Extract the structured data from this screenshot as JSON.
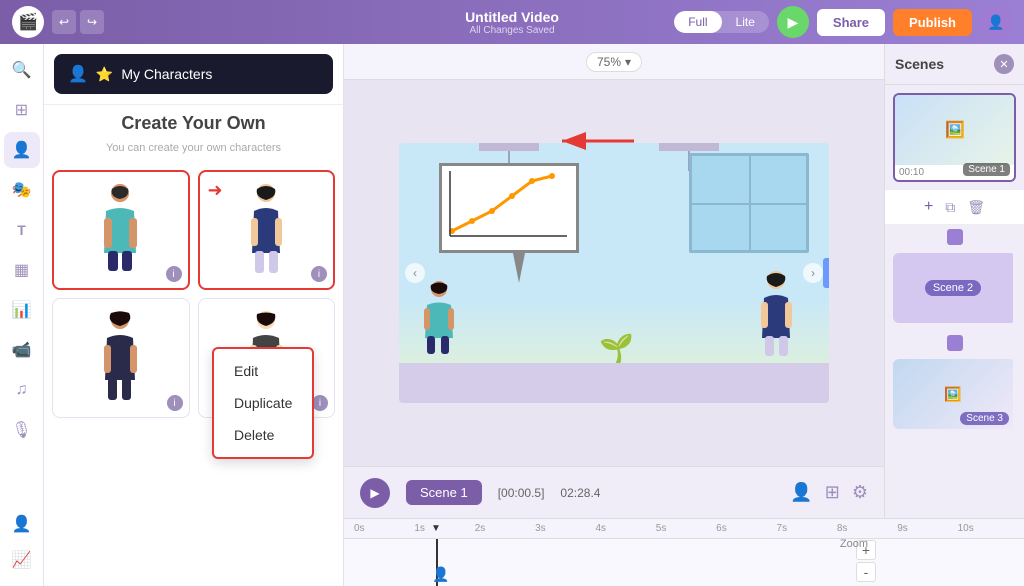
{
  "app": {
    "logo": "🎬",
    "title": "Untitled Video",
    "subtitle": "All Changes Saved",
    "toggle": {
      "full": "Full",
      "lite": "Lite"
    },
    "play_btn": "▶",
    "share_btn": "Share",
    "publish_btn": "Publish"
  },
  "left_nav": {
    "items": [
      {
        "id": "search",
        "icon": "🔍",
        "label": "search-icon"
      },
      {
        "id": "templates",
        "icon": "⊞",
        "label": "templates-icon"
      },
      {
        "id": "characters",
        "icon": "👤",
        "label": "characters-icon",
        "active": true
      },
      {
        "id": "scenes",
        "icon": "🎭",
        "label": "scenes-icon"
      },
      {
        "id": "text",
        "icon": "T",
        "label": "text-icon"
      },
      {
        "id": "assets",
        "icon": "▦",
        "label": "assets-icon"
      },
      {
        "id": "charts",
        "icon": "📊",
        "label": "charts-icon"
      },
      {
        "id": "video",
        "icon": "📹",
        "label": "video-icon"
      },
      {
        "id": "music",
        "icon": "♫",
        "label": "music-icon"
      },
      {
        "id": "voiceover",
        "icon": "🎙",
        "label": "voiceover-icon"
      }
    ]
  },
  "panel": {
    "my_characters_btn": "My Characters",
    "create_your_own": "Create Your Own",
    "hint": "You can create your own characters",
    "characters": [
      {
        "id": 1,
        "figure": "🧍",
        "selected": true
      },
      {
        "id": 2,
        "figure": "🧍"
      },
      {
        "id": 3,
        "figure": "🧍"
      },
      {
        "id": 4,
        "figure": "🧍"
      }
    ]
  },
  "context_menu": {
    "items": [
      "Edit",
      "Duplicate",
      "Delete"
    ]
  },
  "canvas": {
    "zoom": "75%",
    "scene_label": "Scene 1",
    "time_start": "[00:00.5]",
    "time_total": "02:28.4"
  },
  "timeline": {
    "ticks": [
      "0s",
      "1s",
      "2s",
      "3s",
      "4s",
      "5s",
      "6s",
      "7s",
      "8s",
      "9s",
      "10s"
    ]
  },
  "scenes_panel": {
    "title": "Scenes",
    "scenes": [
      {
        "id": "scene1",
        "label": "Scene 1",
        "time": "00:10",
        "active": true
      },
      {
        "id": "scene2",
        "label": "Scene 2"
      },
      {
        "id": "scene3",
        "label": "Scene 3"
      }
    ]
  },
  "zoom_control": {
    "label": "Zoom",
    "plus": "+",
    "minus": "-"
  }
}
